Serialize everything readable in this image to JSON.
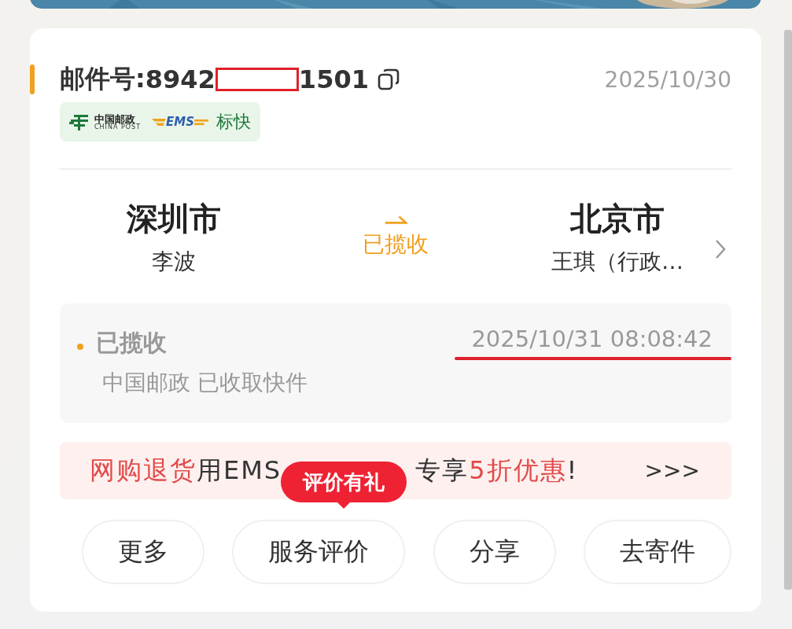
{
  "header": {
    "label": "邮件号:",
    "number_parts": [
      {
        "kind": "text",
        "text": "8942"
      },
      {
        "kind": "redaction"
      },
      {
        "kind": "text",
        "text": "1501"
      }
    ],
    "date": "2025/10/30"
  },
  "carrier": {
    "name_cn": "中国邮政",
    "name_en": "CHINA POST",
    "brand": "EMS",
    "service": "标快"
  },
  "route": {
    "from": {
      "city": "深圳市",
      "person": "李波"
    },
    "status": "已揽收",
    "to": {
      "city": "北京市",
      "person": "王琪（行政…"
    }
  },
  "event": {
    "title": "已揽收",
    "time": "2025/10/31 08:08:42",
    "time_underlined": true,
    "description": "中国邮政 已收取快件"
  },
  "banner": {
    "segments_before": [
      {
        "text": "网购退货",
        "highlight": true
      },
      {
        "text": "用EMS",
        "highlight": false
      }
    ],
    "segments_after": [
      {
        "text": "专享",
        "highlight": false
      },
      {
        "text": "5折优惠",
        "highlight": true
      },
      {
        "text": "!",
        "highlight": false
      }
    ],
    "more": ">>>"
  },
  "buttons": [
    {
      "label": "更多"
    },
    {
      "label": "服务评价",
      "badge": "评价有礼"
    },
    {
      "label": "分享"
    },
    {
      "label": "去寄件"
    }
  ]
}
